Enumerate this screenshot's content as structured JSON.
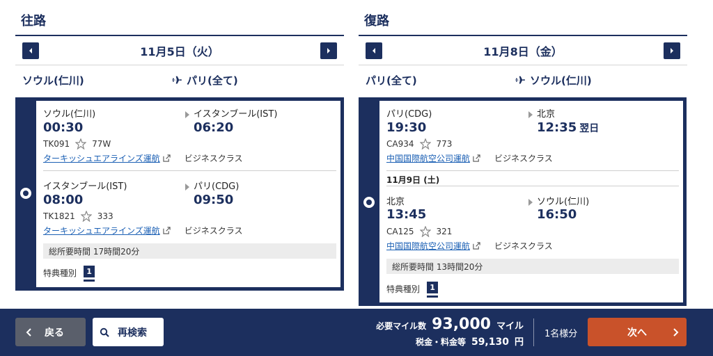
{
  "outbound": {
    "heading": "往路",
    "date": "11月5日（火）",
    "from": "ソウル(仁川)",
    "to": "パリ(全て)",
    "segments": [
      {
        "dep_city": "ソウル(仁川)",
        "dep_time": "00:30",
        "arr_city": "イスタンブール(IST)",
        "arr_time": "06:20",
        "flight": "TK091",
        "aircraft": "77W",
        "operator": "ターキッシュエアラインズ運航",
        "cabin": "ビジネスクラス"
      },
      {
        "dep_city": "イスタンブール(IST)",
        "dep_time": "08:00",
        "arr_city": "パリ(CDG)",
        "arr_time": "09:50",
        "flight": "TK1821",
        "aircraft": "333",
        "operator": "ターキッシュエアラインズ運航",
        "cabin": "ビジネスクラス"
      }
    ],
    "total_time": "総所要時間 17時間20分",
    "award_label": "特典種別",
    "award_value": "1"
  },
  "return": {
    "heading": "復路",
    "date": "11月8日（金）",
    "from": "パリ(全て)",
    "to": "ソウル(仁川)",
    "segments": [
      {
        "dep_city": "パリ(CDG)",
        "dep_time": "19:30",
        "arr_city": "北京",
        "arr_time": "12:35",
        "arr_note": "翌日",
        "flight": "CA934",
        "aircraft": "773",
        "operator": "中国国際航空公司運航",
        "cabin": "ビジネスクラス"
      },
      {
        "date": "11月9日 (土)",
        "dep_city": "北京",
        "dep_time": "13:45",
        "arr_city": "ソウル(仁川)",
        "arr_time": "16:50",
        "flight": "CA125",
        "aircraft": "321",
        "operator": "中国国際航空公司運航",
        "cabin": "ビジネスクラス"
      }
    ],
    "total_time": "総所要時間 13時間20分",
    "award_label": "特典種別",
    "award_value": "1"
  },
  "footer": {
    "back_label": "戻る",
    "research_label": "再検索",
    "miles_label": "必要マイル数",
    "miles_value": "93,000",
    "miles_unit": "マイル",
    "tax_label": "税金・料金等",
    "tax_value": "59,130",
    "tax_unit": "円",
    "pax_label": "1名様分",
    "next_label": "次へ"
  },
  "colors": {
    "navy": "#1c2f5e",
    "next": "#c9522a",
    "back": "#5a5f6b",
    "link": "#1a5fb4"
  }
}
